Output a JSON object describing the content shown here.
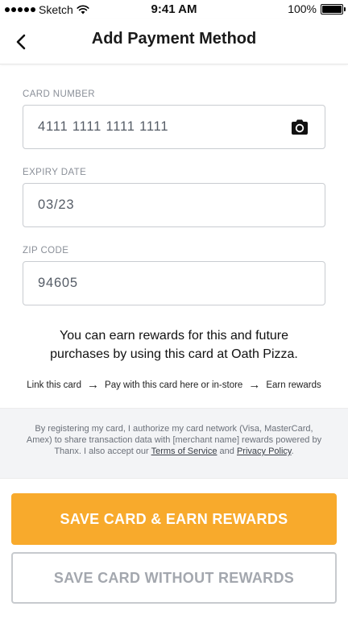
{
  "status_bar": {
    "carrier": "Sketch",
    "time": "9:41 AM",
    "battery": "100%",
    "battery_level": 1.0
  },
  "nav": {
    "title": "Add Payment Method",
    "back_icon": "chevron-left-icon"
  },
  "form": {
    "card_number": {
      "label": "CARD NUMBER",
      "value": "4111 1111 1111 1111",
      "icon": "camera-icon"
    },
    "expiry": {
      "label": "EXPIRY DATE",
      "value": "03/23"
    },
    "zip": {
      "label": "ZIP CODE",
      "value": "94605"
    }
  },
  "rewards": {
    "line1": "You can earn rewards for this and future",
    "line2": "purchases by using this card at Oath Pizza.",
    "steps": [
      "Link this card",
      "Pay with this card here or in-store",
      "Earn rewards"
    ]
  },
  "disclaimer": {
    "text_before": "By registering my card, I authorize my card network (Visa, MasterCard, Amex) to share transaction data with [merchant name] rewards powered by Thanx. I also accept our ",
    "terms_link": "Terms of Service",
    "and": " and ",
    "privacy_link": "Privacy Policy",
    "end": "."
  },
  "buttons": {
    "primary": "SAVE CARD & EARN REWARDS",
    "secondary": "SAVE CARD WITHOUT REWARDS"
  },
  "colors": {
    "accent": "#f8aa2c",
    "secondary_text": "#a3a7ae",
    "label_gray": "#8a8f98"
  }
}
